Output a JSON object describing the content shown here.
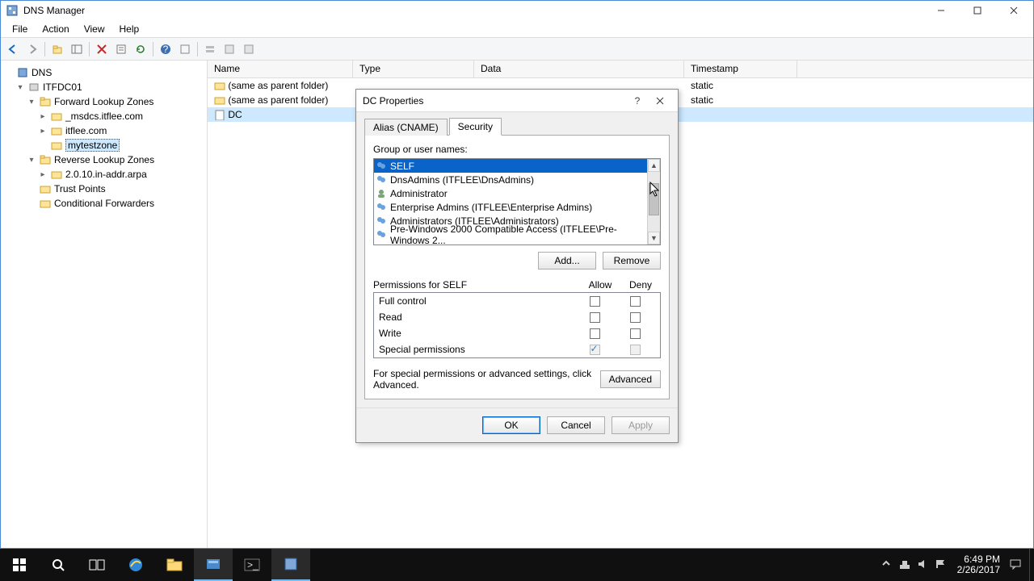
{
  "app": {
    "title": "DNS Manager"
  },
  "menu": {
    "file": "File",
    "action": "Action",
    "view": "View",
    "help": "Help"
  },
  "tree": {
    "root": "DNS",
    "server": "ITFDC01",
    "flz": "Forward Lookup Zones",
    "flz_items": {
      "msdcs": "_msdcs.itflee.com",
      "itflee": "itflee.com",
      "mytestzone": "mytestzone"
    },
    "rlz": "Reverse Lookup Zones",
    "rlz_items": {
      "arpa": "2.0.10.in-addr.arpa"
    },
    "trust": "Trust Points",
    "cond": "Conditional Forwarders"
  },
  "list": {
    "headers": {
      "name": "Name",
      "type": "Type",
      "data": "Data",
      "timestamp": "Timestamp"
    },
    "rows": [
      {
        "name": "(same as parent folder)",
        "type": "",
        "data": "",
        "timestamp": "static"
      },
      {
        "name": "(same as parent folder)",
        "type": "",
        "data": "",
        "timestamp": "static"
      },
      {
        "name": "DC",
        "type": "",
        "data": "",
        "timestamp": ""
      }
    ]
  },
  "dialog": {
    "title": "DC Properties",
    "tabs": {
      "alias": "Alias (CNAME)",
      "security": "Security"
    },
    "group_label": "Group or user names:",
    "groups": [
      "SELF",
      "DnsAdmins (ITFLEE\\DnsAdmins)",
      "Administrator",
      "Enterprise Admins (ITFLEE\\Enterprise Admins)",
      "Administrators (ITFLEE\\Administrators)",
      "Pre-Windows 2000 Compatible Access (ITFLEE\\Pre-Windows 2..."
    ],
    "add": "Add...",
    "remove": "Remove",
    "perm_label": "Permissions for SELF",
    "allow": "Allow",
    "deny": "Deny",
    "perms": {
      "full": "Full control",
      "read": "Read",
      "write": "Write",
      "special": "Special permissions"
    },
    "adv_text": "For special permissions or advanced settings, click Advanced.",
    "advanced": "Advanced",
    "ok": "OK",
    "cancel": "Cancel",
    "apply": "Apply"
  },
  "taskbar": {
    "time": "6:49 PM",
    "date": "2/26/2017"
  }
}
